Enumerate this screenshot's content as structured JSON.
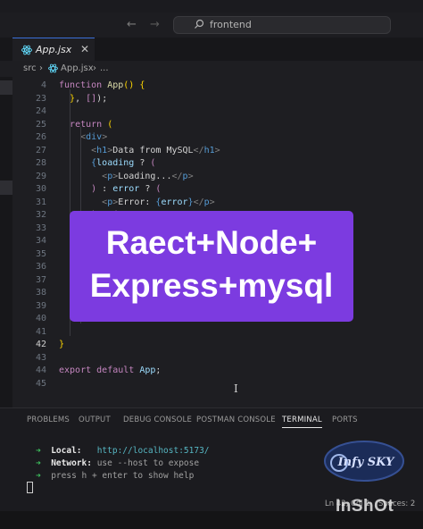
{
  "titlebar": {
    "search_text": "frontend"
  },
  "tab": {
    "label": "App.jsx",
    "close": "✕"
  },
  "breadcrumb": {
    "folder": "src",
    "sep": "›",
    "file": "App.jsx",
    "sep2": "›",
    "more": "..."
  },
  "editor": {
    "lines": [
      {
        "n": "4",
        "html": "<span class='kw'>function</span> <span class='fn'>App</span><span class='br'>()</span> <span class='br'>{</span>"
      },
      {
        "n": "23",
        "html": "  <span class='br'>}</span>, <span class='kw'>[]</span>);"
      },
      {
        "n": "24",
        "html": ""
      },
      {
        "n": "25",
        "html": "  <span class='kw'>return</span> <span class='br'>(</span>"
      },
      {
        "n": "26",
        "html": "    <span class='ang'>&lt;</span><span class='tag'>div</span><span class='ang'>&gt;</span>"
      },
      {
        "n": "27",
        "html": "      <span class='ang'>&lt;</span><span class='tag'>h1</span><span class='ang'>&gt;</span>Data from MySQL<span class='ang'>&lt;/</span><span class='tag'>h1</span><span class='ang'>&gt;</span>"
      },
      {
        "n": "28",
        "html": "      <span class='tag'>{</span><span class='vr'>loading</span> ? <span class='kw'>(</span>"
      },
      {
        "n": "29",
        "html": "        <span class='ang'>&lt;</span><span class='tag'>p</span><span class='ang'>&gt;</span>Loading...<span class='ang'>&lt;/</span><span class='tag'>p</span><span class='ang'>&gt;</span>"
      },
      {
        "n": "30",
        "html": "      <span class='kw'>)</span> : <span class='vr'>error</span> ? <span class='kw'>(</span>"
      },
      {
        "n": "31",
        "html": "        <span class='ang'>&lt;</span><span class='tag'>p</span><span class='ang'>&gt;</span>Error: <span class='tag'>{</span><span class='vr'>error</span><span class='tag'>}</span><span class='ang'>&lt;/</span><span class='tag'>p</span><span class='ang'>&gt;</span>"
      },
      {
        "n": "32",
        "html": "      <span class='kw'>)</span> : <span class='kw'>(</span>"
      },
      {
        "n": "33",
        "html": ""
      },
      {
        "n": "34",
        "html": ""
      },
      {
        "n": "35",
        "html": ""
      },
      {
        "n": "36",
        "html": ""
      },
      {
        "n": "37",
        "html": ""
      },
      {
        "n": "38",
        "html": ""
      },
      {
        "n": "39",
        "html": ""
      },
      {
        "n": "40",
        "html": ""
      },
      {
        "n": "41",
        "html": ""
      },
      {
        "n": "42",
        "html": "<span class='br'>}</span>",
        "active": true
      },
      {
        "n": "43",
        "html": ""
      },
      {
        "n": "44",
        "html": "<span class='kw'>export</span> <span class='kw'>default</span> <span class='vr'>App</span>;"
      },
      {
        "n": "45",
        "html": ""
      }
    ]
  },
  "banner": {
    "line1": "Raect+Node+",
    "line2": "Express+mysql"
  },
  "panel": {
    "tabs": [
      "PROBLEMS",
      "OUTPUT",
      "DEBUG CONSOLE",
      "POSTMAN CONSOLE",
      "TERMINAL",
      "PORTS"
    ],
    "active_tab": "TERMINAL",
    "terminal": {
      "local_label": "Local:",
      "local_url": "http://localhost:5173/",
      "network_label": "Network:",
      "network_text": "use --host to expose",
      "help_text": "press h + enter to show help"
    }
  },
  "status": {
    "position": "Ln 42, Col 1",
    "spaces": "Spaces: 2"
  },
  "watermark": {
    "logo_text": "Infy SKY",
    "inshot": "InShOt"
  },
  "colors": {
    "banner": "#7c3be0",
    "accent": "#3a6fd8",
    "terminal_arrow": "#3ec45f"
  }
}
